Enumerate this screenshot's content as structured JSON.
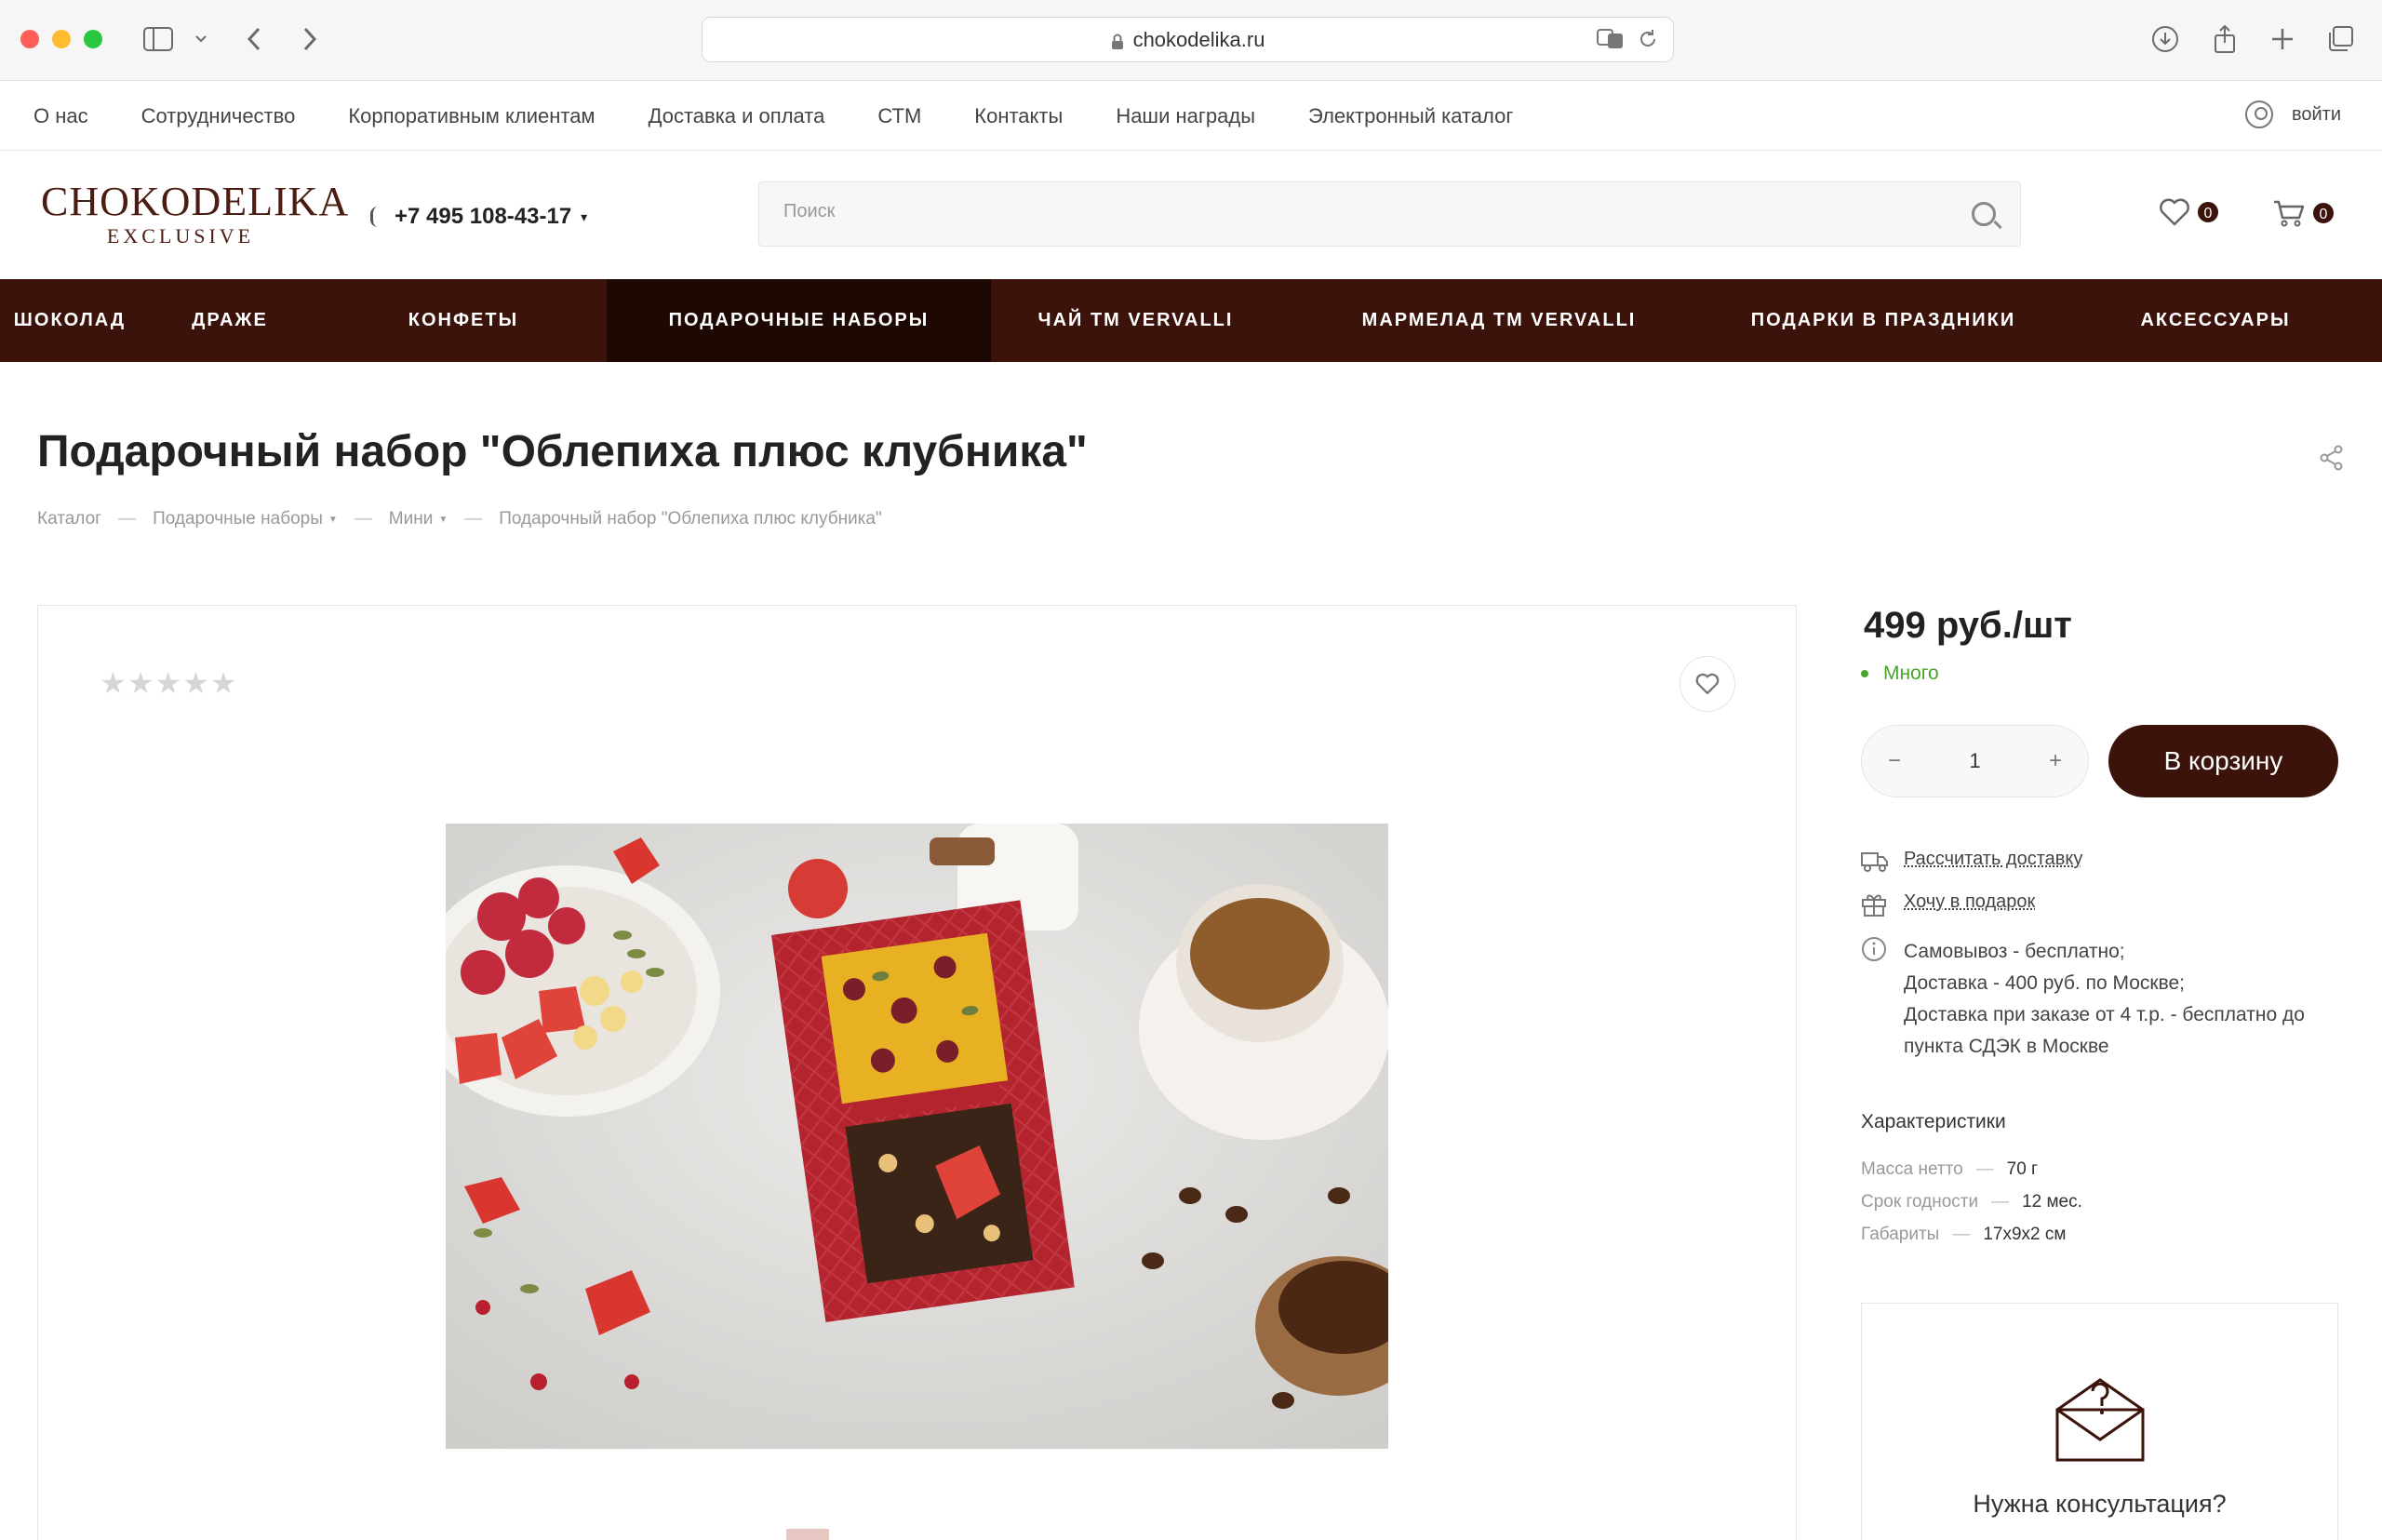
{
  "browser": {
    "url": "chokodelika.ru"
  },
  "topbar": {
    "links": [
      "О нас",
      "Сотрудничество",
      "Корпоративным клиентам",
      "Доставка и оплата",
      "СТМ",
      "Контакты",
      "Наши награды",
      "Электронный каталог"
    ],
    "login_label": "войти"
  },
  "header": {
    "logo_main": "CHOKODELIKA",
    "logo_sub": "EXCLUSIVE",
    "phone": "+7 495 108-43-17",
    "search_placeholder": "Поиск",
    "favorites_count": "0",
    "cart_count": "0"
  },
  "categories": {
    "items": [
      "ШОКОЛАД",
      "ДРАЖЕ",
      "КОНФЕТЫ",
      "ПОДАРОЧНЫЕ НАБОРЫ",
      "ЧАЙ ТМ VERVALLI",
      "МАРМЕЛАД ТМ VERVALLI",
      "ПОДАРКИ В ПРАЗДНИКИ",
      "АКСЕССУАРЫ"
    ],
    "active": "ПОДАРОЧНЫЕ НАБОРЫ"
  },
  "product": {
    "title": "Подарочный набор \"Облепиха плюс клубника\"",
    "breadcrumb": [
      "Каталог",
      "Подарочные наборы",
      "Мини",
      "Подарочный набор \"Облепиха плюс клубника\""
    ],
    "rating": 0,
    "stars": "★★★★★",
    "price": "499 руб./шт",
    "stock": "Много",
    "quantity": "1",
    "qty_minus": "−",
    "qty_plus": "+",
    "add_to_cart": "В корзину",
    "calc_delivery": "Рассчитать доставку",
    "want_gift": "Хочу в подарок",
    "delivery_lines": [
      "Самовывоз - бесплатно;",
      "Доставка - 400 руб. по Москве;",
      "Доставка при заказе от 4 т.р. - бесплатно до",
      "пункта СДЭК в Москве"
    ],
    "characteristics_title": "Характеристики",
    "characteristics": [
      {
        "name": "Масса нетто",
        "value": "70 г"
      },
      {
        "name": "Срок годности",
        "value": "12 мес."
      },
      {
        "name": "Габариты",
        "value": "17х9х2 см"
      }
    ],
    "dash": "—",
    "consult_text": "Нужна консультация?"
  },
  "colors": {
    "brand": "#3b130b",
    "brand_active": "#1e0804",
    "in_stock": "#4aa52a"
  }
}
